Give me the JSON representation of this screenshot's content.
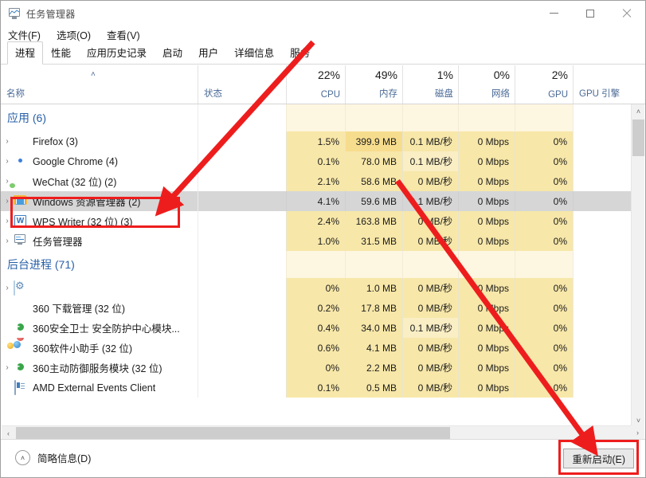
{
  "window": {
    "title": "任务管理器",
    "icon": "task-manager-icon",
    "controls": {
      "minimize": "—",
      "maximize": "□",
      "close": "✕"
    }
  },
  "menu": {
    "items": [
      "文件(F)",
      "选项(O)",
      "查看(V)"
    ]
  },
  "tabs": {
    "active_index": 0,
    "items": [
      "进程",
      "性能",
      "应用历史记录",
      "启动",
      "用户",
      "详细信息",
      "服务"
    ]
  },
  "columns": [
    {
      "key": "name",
      "label": "名称",
      "pct": "",
      "align": "left",
      "sorted": true
    },
    {
      "key": "status",
      "label": "状态",
      "pct": "",
      "align": "left",
      "sorted": false
    },
    {
      "key": "cpu",
      "label": "CPU",
      "pct": "22%",
      "align": "right",
      "sorted": false
    },
    {
      "key": "memory",
      "label": "内存",
      "pct": "49%",
      "align": "right",
      "sorted": false
    },
    {
      "key": "disk",
      "label": "磁盘",
      "pct": "1%",
      "align": "right",
      "sorted": false
    },
    {
      "key": "network",
      "label": "网络",
      "pct": "0%",
      "align": "right",
      "sorted": false
    },
    {
      "key": "gpu",
      "label": "GPU",
      "pct": "2%",
      "align": "right",
      "sorted": false
    },
    {
      "key": "gpuengine",
      "label": "GPU 引擎",
      "pct": "",
      "align": "left",
      "sorted": false
    }
  ],
  "groups": [
    {
      "title": "应用 (6)",
      "rows": [
        {
          "name": "Firefox (3)",
          "icon": "firefox-icon",
          "expandable": true,
          "cpu": "1.5%",
          "memory": "399.9 MB",
          "disk": "0.1 MB/秒",
          "network": "0 Mbps",
          "gpu": "0%",
          "gpuengine": "",
          "selected": false,
          "memory_hot": true,
          "disk_hot": false
        },
        {
          "name": "Google Chrome (4)",
          "icon": "chrome-icon",
          "expandable": true,
          "cpu": "0.1%",
          "memory": "78.0 MB",
          "disk": "0.1 MB/秒",
          "network": "0 Mbps",
          "gpu": "0%",
          "gpuengine": "",
          "selected": false,
          "memory_hot": false,
          "disk_hot": true
        },
        {
          "name": "WeChat (32 位) (2)",
          "icon": "wechat-icon",
          "expandable": true,
          "cpu": "2.1%",
          "memory": "58.6 MB",
          "disk": "0 MB/秒",
          "network": "0 Mbps",
          "gpu": "0%",
          "gpuengine": "",
          "selected": false,
          "memory_hot": false,
          "disk_hot": false
        },
        {
          "name": "Windows 资源管理器 (2)",
          "icon": "explorer-icon",
          "expandable": true,
          "cpu": "4.1%",
          "memory": "59.6 MB",
          "disk": "0.1 MB/秒",
          "network": "0 Mbps",
          "gpu": "0%",
          "gpuengine": "",
          "selected": true,
          "memory_hot": false,
          "disk_hot": false
        },
        {
          "name": "WPS Writer (32 位) (3)",
          "icon": "wps-icon",
          "expandable": true,
          "cpu": "2.4%",
          "memory": "163.8 MB",
          "disk": "0 MB/秒",
          "network": "0 Mbps",
          "gpu": "0%",
          "gpuengine": "",
          "selected": false,
          "memory_hot": false,
          "disk_hot": false
        },
        {
          "name": "任务管理器",
          "icon": "task-manager-icon",
          "expandable": true,
          "cpu": "1.0%",
          "memory": "31.5 MB",
          "disk": "0 MB/秒",
          "network": "0 Mbps",
          "gpu": "0%",
          "gpuengine": "",
          "selected": false,
          "memory_hot": false,
          "disk_hot": false
        }
      ]
    },
    {
      "title": "后台进程 (71)",
      "rows": [
        {
          "name": "",
          "icon": "gear-icon",
          "expandable": true,
          "cpu": "0%",
          "memory": "1.0 MB",
          "disk": "0 MB/秒",
          "network": "0 Mbps",
          "gpu": "0%",
          "gpuengine": "",
          "selected": false,
          "memory_hot": false,
          "disk_hot": false
        },
        {
          "name": "360 下载管理 (32 位)",
          "icon": "360-download-icon",
          "expandable": false,
          "cpu": "0.2%",
          "memory": "17.8 MB",
          "disk": "0 MB/秒",
          "network": "0 Mbps",
          "gpu": "0%",
          "gpuengine": "",
          "selected": false,
          "memory_hot": false,
          "disk_hot": false
        },
        {
          "name": "360安全卫士 安全防护中心模块...",
          "icon": "360-shield-icon",
          "expandable": false,
          "cpu": "0.4%",
          "memory": "34.0 MB",
          "disk": "0.1 MB/秒",
          "network": "0 Mbps",
          "gpu": "0%",
          "gpuengine": "",
          "selected": false,
          "memory_hot": false,
          "disk_hot": true
        },
        {
          "name": "360软件小助手 (32 位)",
          "icon": "360-helper-icon",
          "expandable": false,
          "cpu": "0.6%",
          "memory": "4.1 MB",
          "disk": "0 MB/秒",
          "network": "0 Mbps",
          "gpu": "0%",
          "gpuengine": "",
          "selected": false,
          "memory_hot": false,
          "disk_hot": false
        },
        {
          "name": "360主动防御服务模块 (32 位)",
          "icon": "360-shield-icon",
          "expandable": true,
          "cpu": "0%",
          "memory": "2.2 MB",
          "disk": "0 MB/秒",
          "network": "0 Mbps",
          "gpu": "0%",
          "gpuengine": "",
          "selected": false,
          "memory_hot": false,
          "disk_hot": false
        },
        {
          "name": "AMD External Events Client",
          "icon": "amd-icon",
          "expandable": false,
          "cpu": "0.1%",
          "memory": "0.5 MB",
          "disk": "0 MB/秒",
          "network": "0 Mbps",
          "gpu": "0%",
          "gpuengine": "",
          "selected": false,
          "memory_hot": false,
          "disk_hot": false
        }
      ]
    }
  ],
  "scrollbars": {
    "vertical": {
      "up": "˄",
      "down": "˅"
    },
    "horizontal": {
      "left": "‹",
      "right": "›"
    }
  },
  "bottom": {
    "fewer_details_label": "简略信息(D)",
    "fewer_details_chevron": "˄",
    "restart_label": "重新启动(E)"
  },
  "annotations": {
    "highlight_color": "#ee1d1d",
    "boxes": [
      "explorer-row",
      "restart-button"
    ],
    "arrows": [
      "arrow-to-explorer-row",
      "arrow-to-restart-button"
    ]
  }
}
